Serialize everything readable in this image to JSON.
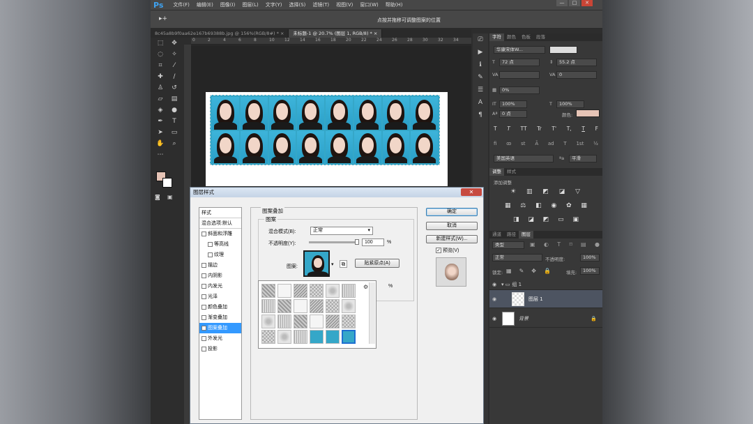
{
  "app": {
    "logo": "Ps",
    "menus": [
      "文件(F)",
      "编辑(E)",
      "图像(I)",
      "图层(L)",
      "文字(Y)",
      "选择(S)",
      "滤镜(T)",
      "视图(V)",
      "窗口(W)",
      "帮助(H)"
    ],
    "window_buttons": [
      "—",
      "□",
      "✕"
    ]
  },
  "options_bar": {
    "tool_glyph": "▸+",
    "hint": "点按并拖移可调整图案的位置"
  },
  "doc_tabs": [
    {
      "label": "8c45a8b9f0aa62e167b69388b.jpg @ 156%(RGB/8#) *",
      "close": "×",
      "active": false
    },
    {
      "label": "未标题-1 @ 20.7% (图层 1, RGB/8) *",
      "close": "×",
      "active": true
    }
  ],
  "ruler_labels": [
    "0",
    "2",
    "4",
    "6",
    "8",
    "10",
    "12",
    "14",
    "16",
    "18",
    "20",
    "22",
    "24",
    "26",
    "28",
    "30",
    "32",
    "34"
  ],
  "character_panel": {
    "tabs": [
      "字符",
      "颜色",
      "色板",
      "段落"
    ],
    "font_family": "华康宋体W...",
    "font_size": "72 点",
    "leading": "55.2 点",
    "tracking": "0",
    "vertical_scale": "0%",
    "scale_v": "100%",
    "scale_h": "100%",
    "baseline": "0 点",
    "color_label": "颜色:",
    "color": "#e6c4b6",
    "type_styles": [
      "T",
      "T",
      "TT",
      "Tr",
      "T'",
      "T,",
      "T",
      "F"
    ],
    "language": "美国英语",
    "aa": "平滑"
  },
  "adjustments_panel": {
    "tabs": [
      "调整",
      "样式"
    ],
    "title": "添加调整"
  },
  "layers_panel": {
    "tabs": [
      "通道",
      "路径",
      "图层"
    ],
    "kind": "类型",
    "blend_mode": "正常",
    "opacity_label": "不透明度:",
    "opacity": "100%",
    "lock_label": "锁定:",
    "fill_label": "填充:",
    "fill": "100%",
    "layers": [
      {
        "name": "组 1",
        "type": "group"
      },
      {
        "name": "图层 1",
        "type": "layer",
        "selected": true
      },
      {
        "name": "背景",
        "type": "background"
      }
    ]
  },
  "dialog": {
    "title": "图层样式",
    "close": "✕",
    "styles": [
      {
        "label": "样式",
        "check": false,
        "head": true
      },
      {
        "label": "混合选项:默认",
        "check": false,
        "head": true
      },
      {
        "label": "斜面和浮雕",
        "check": true,
        "checked": false
      },
      {
        "label": "等高线",
        "check": true,
        "checked": false,
        "indent": true
      },
      {
        "label": "纹理",
        "check": true,
        "checked": false,
        "indent": true
      },
      {
        "label": "描边",
        "check": true,
        "checked": false
      },
      {
        "label": "内阴影",
        "check": true,
        "checked": false
      },
      {
        "label": "内发光",
        "check": true,
        "checked": false
      },
      {
        "label": "光泽",
        "check": true,
        "checked": false
      },
      {
        "label": "颜色叠加",
        "check": true,
        "checked": false
      },
      {
        "label": "渐变叠加",
        "check": true,
        "checked": false
      },
      {
        "label": "图案叠加",
        "check": true,
        "checked": true,
        "selected": true
      },
      {
        "label": "外发光",
        "check": true,
        "checked": false
      },
      {
        "label": "投影",
        "check": true,
        "checked": false
      }
    ],
    "section_title": "图案叠加",
    "group_title": "图案",
    "blend_label": "混合模式(B):",
    "blend_value": "正常",
    "opacity_label": "不透明度(Y):",
    "opacity_value": "100",
    "percent": "%",
    "pattern_label": "图案:",
    "snap_button": "贴紧原点(A)",
    "ok_button": "确定",
    "cancel_button": "取消",
    "new_style_button": "新建样式(W)...",
    "preview_label": "预览(V)",
    "preview_checked": true,
    "scale_percent": "%"
  }
}
